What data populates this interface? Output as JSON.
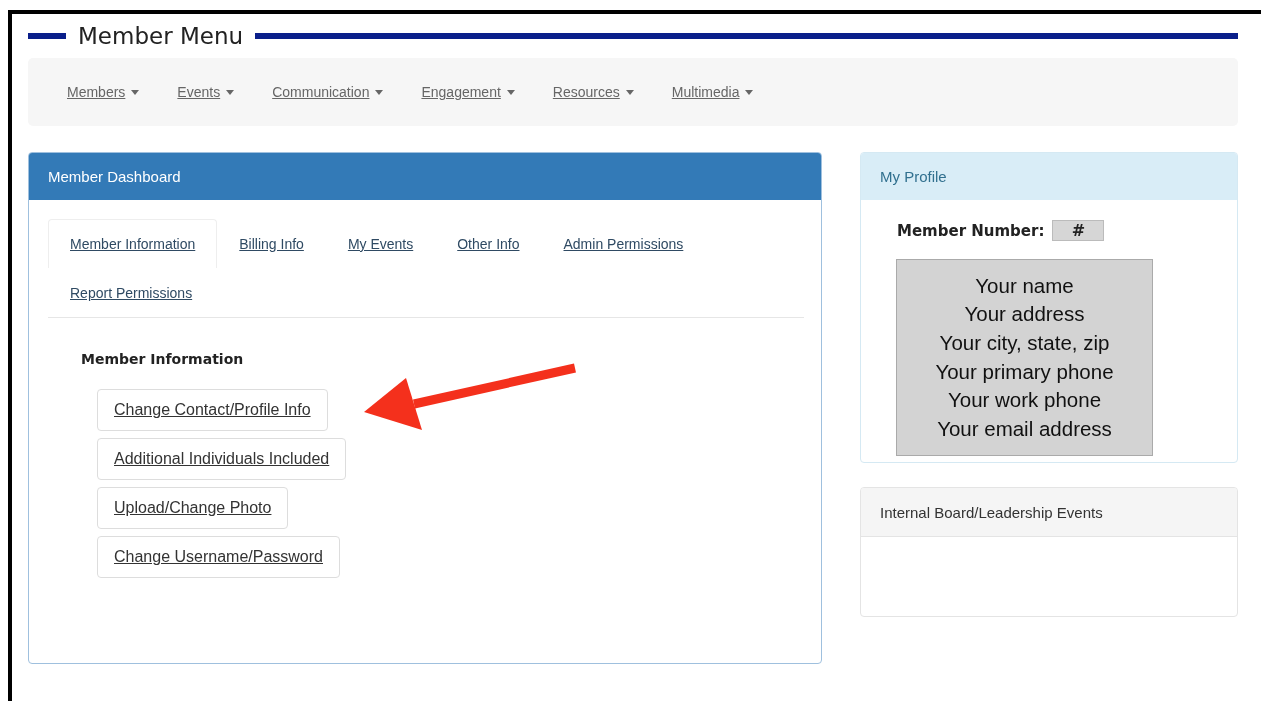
{
  "title": "Member Menu",
  "nav": [
    {
      "label": "Members"
    },
    {
      "label": "Events"
    },
    {
      "label": "Communication"
    },
    {
      "label": "Engagement"
    },
    {
      "label": "Resources"
    },
    {
      "label": "Multimedia"
    }
  ],
  "dashboard": {
    "title": "Member Dashboard",
    "tabs": [
      {
        "label": "Member Information",
        "selected": true
      },
      {
        "label": "Billing Info",
        "selected": false
      },
      {
        "label": "My Events",
        "selected": false
      },
      {
        "label": "Other Info",
        "selected": false
      },
      {
        "label": "Admin Permissions",
        "selected": false
      },
      {
        "label": "Report Permissions",
        "selected": false
      }
    ],
    "section_title": "Member Information",
    "buttons": [
      "Change Contact/Profile Info",
      "Additional Individuals Included",
      "Upload/Change Photo",
      "Change Username/Password"
    ]
  },
  "profile": {
    "title": "My Profile",
    "member_number_label": "Member Number:",
    "member_number": "#",
    "card_lines": [
      "Your name",
      "Your address",
      "Your city, state, zip",
      "Your primary phone",
      "Your work phone",
      "Your email address"
    ]
  },
  "events_panel": {
    "title": "Internal Board/Leadership Events"
  }
}
